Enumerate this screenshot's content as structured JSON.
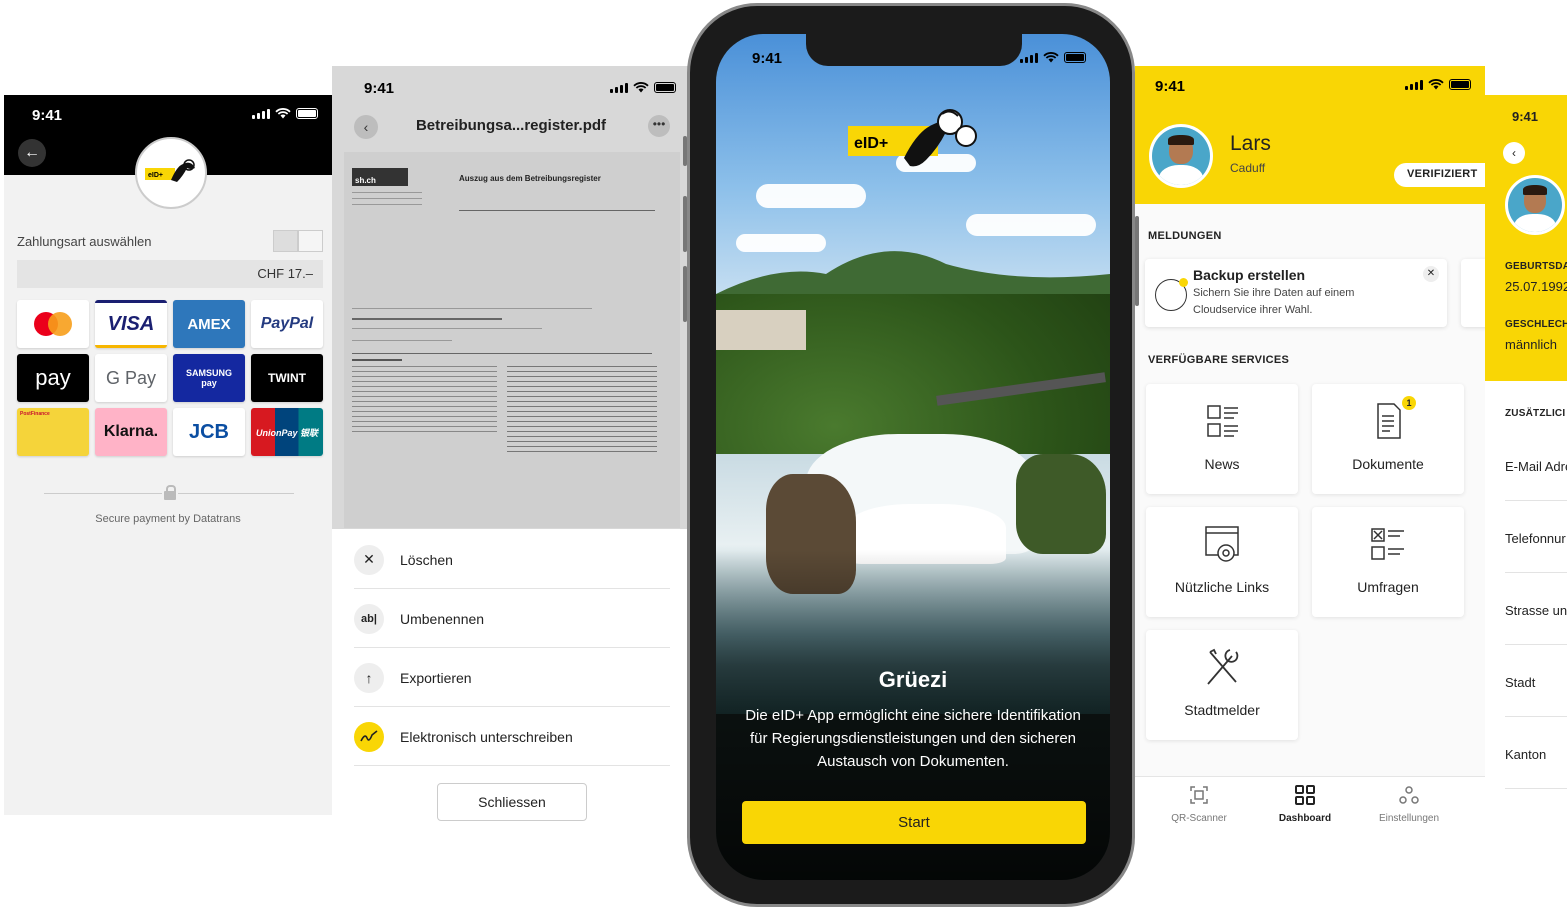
{
  "colors": {
    "brand_yellow": "#f9d605",
    "black": "#000000",
    "gray_bg": "#f2f2f2"
  },
  "payment_screen": {
    "time": "9:41",
    "back_icon": "arrow-left-icon",
    "select_label": "Zahlungsart auswählen",
    "amount": "CHF 17.–",
    "methods": [
      {
        "label": "",
        "icon": "mastercard-logo"
      },
      {
        "label": "VISA",
        "icon": "visa-logo"
      },
      {
        "label": "AMEX",
        "icon": "amex-logo"
      },
      {
        "label": "PayPal",
        "icon": "paypal-logo"
      },
      {
        "label": "pay",
        "icon": "apple-pay-logo"
      },
      {
        "label": "G Pay",
        "icon": "google-pay-logo"
      },
      {
        "label": "SAMSUNG pay",
        "icon": "samsung-pay-logo"
      },
      {
        "label": "TWINT",
        "icon": "twint-logo"
      },
      {
        "label": "PostFinance",
        "icon": "postfinance-card"
      },
      {
        "label": "Klarna.",
        "icon": "klarna-logo"
      },
      {
        "label": "JCB",
        "icon": "jcb-logo"
      },
      {
        "label": "UnionPay 银联",
        "icon": "unionpay-logo"
      }
    ],
    "secure_text": "Secure payment by Datatrans"
  },
  "document_screen": {
    "time": "9:41",
    "title": "Betreibungsa...register.pdf",
    "doc_header": "Auszug aus dem Betreibungsregister",
    "doc_logo": "sh.ch",
    "actions": [
      {
        "label": "Löschen",
        "icon": "close-icon"
      },
      {
        "label": "Umbenennen",
        "icon": "rename-icon",
        "glyph": "ab|"
      },
      {
        "label": "Exportieren",
        "icon": "arrow-up-icon"
      },
      {
        "label": "Elektronisch unterschreiben",
        "icon": "signature-icon"
      }
    ],
    "close_label": "Schliessen"
  },
  "welcome_screen": {
    "time": "9:41",
    "logo_text": "eID+",
    "greeting": "Grüezi",
    "intro": "Die eID+ App ermöglicht eine sichere Identifikation für Regierungsdienstleistungen und den sicheren Austausch von Dokumenten.",
    "start_label": "Start"
  },
  "dashboard_screen": {
    "time": "9:41",
    "first_name": "Lars",
    "last_name": "Caduff",
    "verified": "VERIFIZIERT",
    "messages_heading": "MELDUNGEN",
    "notification": {
      "title": "Backup erstellen",
      "text": "Sichern Sie ihre Daten auf einem Cloudservice ihrer Wahl."
    },
    "services_heading": "VERFÜGBARE SERVICES",
    "services": [
      {
        "label": "News",
        "icon": "news-icon"
      },
      {
        "label": "Dokumente",
        "icon": "document-icon",
        "badge": "1"
      },
      {
        "label": "Nützliche Links",
        "icon": "link-icon"
      },
      {
        "label": "Umfragen",
        "icon": "survey-icon"
      },
      {
        "label": "Stadtmelder",
        "icon": "tools-icon"
      }
    ],
    "tabs": [
      {
        "label": "QR-Scanner",
        "icon": "qr-icon"
      },
      {
        "label": "Dashboard",
        "icon": "dashboard-icon",
        "active": true
      },
      {
        "label": "Einstellungen",
        "icon": "settings-icon"
      }
    ]
  },
  "profile_screen": {
    "time": "9:41",
    "birth_label": "GEBURTSDA",
    "birth_value": "25.07.1992",
    "gender_label": "GESCHLECH",
    "gender_value": "männlich",
    "extra_heading": "ZUSÄTZLICI",
    "fields": [
      "E-Mail Adre",
      "Telefonnur",
      "Strasse un",
      "Stadt",
      "Kanton"
    ]
  }
}
